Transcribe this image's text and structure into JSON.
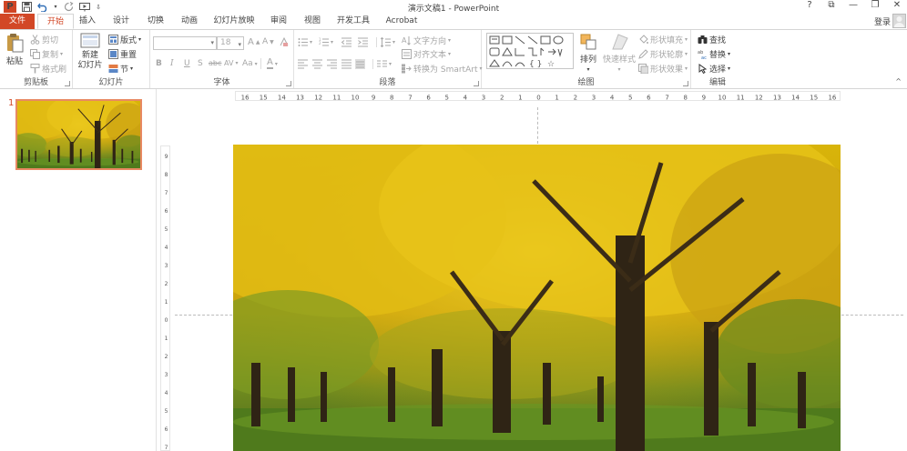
{
  "app": {
    "title": "演示文稿1 - PowerPoint",
    "logo": "P"
  },
  "window_controls": [
    "?",
    "⧉",
    "—",
    "❐",
    "✕"
  ],
  "tabs": [
    {
      "label": "文件",
      "id": "file"
    },
    {
      "label": "开始",
      "id": "home"
    },
    {
      "label": "插入",
      "id": "insert"
    },
    {
      "label": "设计",
      "id": "design"
    },
    {
      "label": "切换",
      "id": "transitions"
    },
    {
      "label": "动画",
      "id": "animations"
    },
    {
      "label": "幻灯片放映",
      "id": "slideshow"
    },
    {
      "label": "审阅",
      "id": "review"
    },
    {
      "label": "视图",
      "id": "view"
    },
    {
      "label": "开发工具",
      "id": "developer"
    },
    {
      "label": "Acrobat",
      "id": "acrobat"
    }
  ],
  "login_label": "登录",
  "ribbon": {
    "clipboard": {
      "label": "剪贴板",
      "paste": "粘贴",
      "cut": "剪切",
      "copy": "复制",
      "format_painter": "格式刷"
    },
    "slides": {
      "label": "幻灯片",
      "new_slide_line1": "新建",
      "new_slide_line2": "幻灯片",
      "layout": "版式",
      "reset": "重置",
      "section": "节"
    },
    "font": {
      "label": "字体",
      "font_name": "",
      "font_size": "18",
      "bold": "B",
      "italic": "I",
      "underline": "U",
      "shadow": "S",
      "strike": "abc",
      "spacing": "AV",
      "case": "Aa",
      "color": "A",
      "grow": "A",
      "shrink": "A"
    },
    "paragraph": {
      "label": "段落",
      "text_direction": "文字方向",
      "align_text": "对齐文本",
      "smartart": "转换为 SmartArt"
    },
    "drawing": {
      "label": "绘图",
      "arrange": "排列",
      "quick_styles": "快速样式",
      "shape_fill": "形状填充",
      "shape_outline": "形状轮廓",
      "shape_effects": "形状效果"
    },
    "editing": {
      "label": "编辑",
      "find": "查找",
      "replace": "替换",
      "select": "选择"
    }
  },
  "slide_pane": {
    "slide_number": "1"
  },
  "ruler": {
    "horizontal": [
      "16",
      "15",
      "14",
      "13",
      "12",
      "11",
      "10",
      "9",
      "8",
      "7",
      "6",
      "5",
      "4",
      "3",
      "2",
      "1",
      "0",
      "1",
      "2",
      "3",
      "4",
      "5",
      "6",
      "7",
      "8",
      "9",
      "10",
      "11",
      "12",
      "13",
      "14",
      "15",
      "16"
    ],
    "vertical": [
      "9",
      "8",
      "7",
      "6",
      "5",
      "4",
      "3",
      "2",
      "1",
      "0",
      "1",
      "2",
      "3",
      "4",
      "5",
      "6",
      "7"
    ]
  },
  "colors": {
    "accent": "#d24726",
    "thumb_border": "#e88962"
  }
}
